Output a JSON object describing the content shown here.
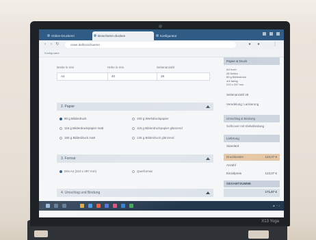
{
  "device": {
    "brand": "X13 Yoga"
  },
  "browser": {
    "tabs": [
      {
        "label": "Online-Druckerei"
      },
      {
        "label": "Broschüren drucken"
      },
      {
        "label": "Konfigurator"
      }
    ],
    "url": "cewe.de/broschueren",
    "bookmark": "Konfigurator"
  },
  "form": {
    "dimensions": {
      "width_label": "Breite in mm",
      "height_label": "Höhe in mm",
      "pages_label": "Seitenanzahl",
      "width_value": "A4",
      "height_value": "40",
      "pages_value": "28"
    },
    "sections": [
      {
        "title": "2. Papier"
      },
      {
        "title": "3. Format"
      },
      {
        "title": "4. Umschlag und Bindung"
      }
    ],
    "paper_options": [
      {
        "label": "80 g Bilderdruck",
        "selected": true
      },
      {
        "label": "100 g Werkdruckpapier",
        "selected": false
      },
      {
        "label": "115 g Bilderdruckpapier matt",
        "selected": false
      },
      {
        "label": "115 g Bilderdruckpapier glänzend",
        "selected": false
      },
      {
        "label": "150 g Bilderdruck matt",
        "selected": false
      },
      {
        "label": "135 g Bilderdruck glänzend",
        "selected": false
      }
    ],
    "format_options": [
      {
        "label": "DIN A4 (210 x 297 mm)",
        "selected": true
      },
      {
        "label": "Querformat",
        "selected": false
      }
    ]
  },
  "sidebar": {
    "summary_head": "Papier & Druck",
    "summary_text": "A4 hoch\n28 Seiten\n80 g Bilderdruck\n4/4 farbig\n210 x 297 mm",
    "rows": [
      {
        "label": "Seitenanzahl 28",
        "value": ""
      },
      {
        "label": "Veredelung: Lackierung",
        "value": ""
      },
      {
        "label": "Umschlag & Bindung",
        "value": "",
        "kind": "head"
      },
      {
        "label": "Softcover mit Klebebindung",
        "value": ""
      },
      {
        "label": "Lieferung",
        "value": "",
        "kind": "head"
      },
      {
        "label": "Standard",
        "value": ""
      },
      {
        "label": "Druckkosten",
        "value": "123,07 €",
        "kind": "hl"
      },
      {
        "label": "Anzahl",
        "value": ""
      },
      {
        "label": "Einzelpreis",
        "value": "123,07 €"
      },
      {
        "label": "GESAMTSUMME",
        "value": "",
        "kind": "total"
      }
    ],
    "total_price": "171,87 €"
  }
}
